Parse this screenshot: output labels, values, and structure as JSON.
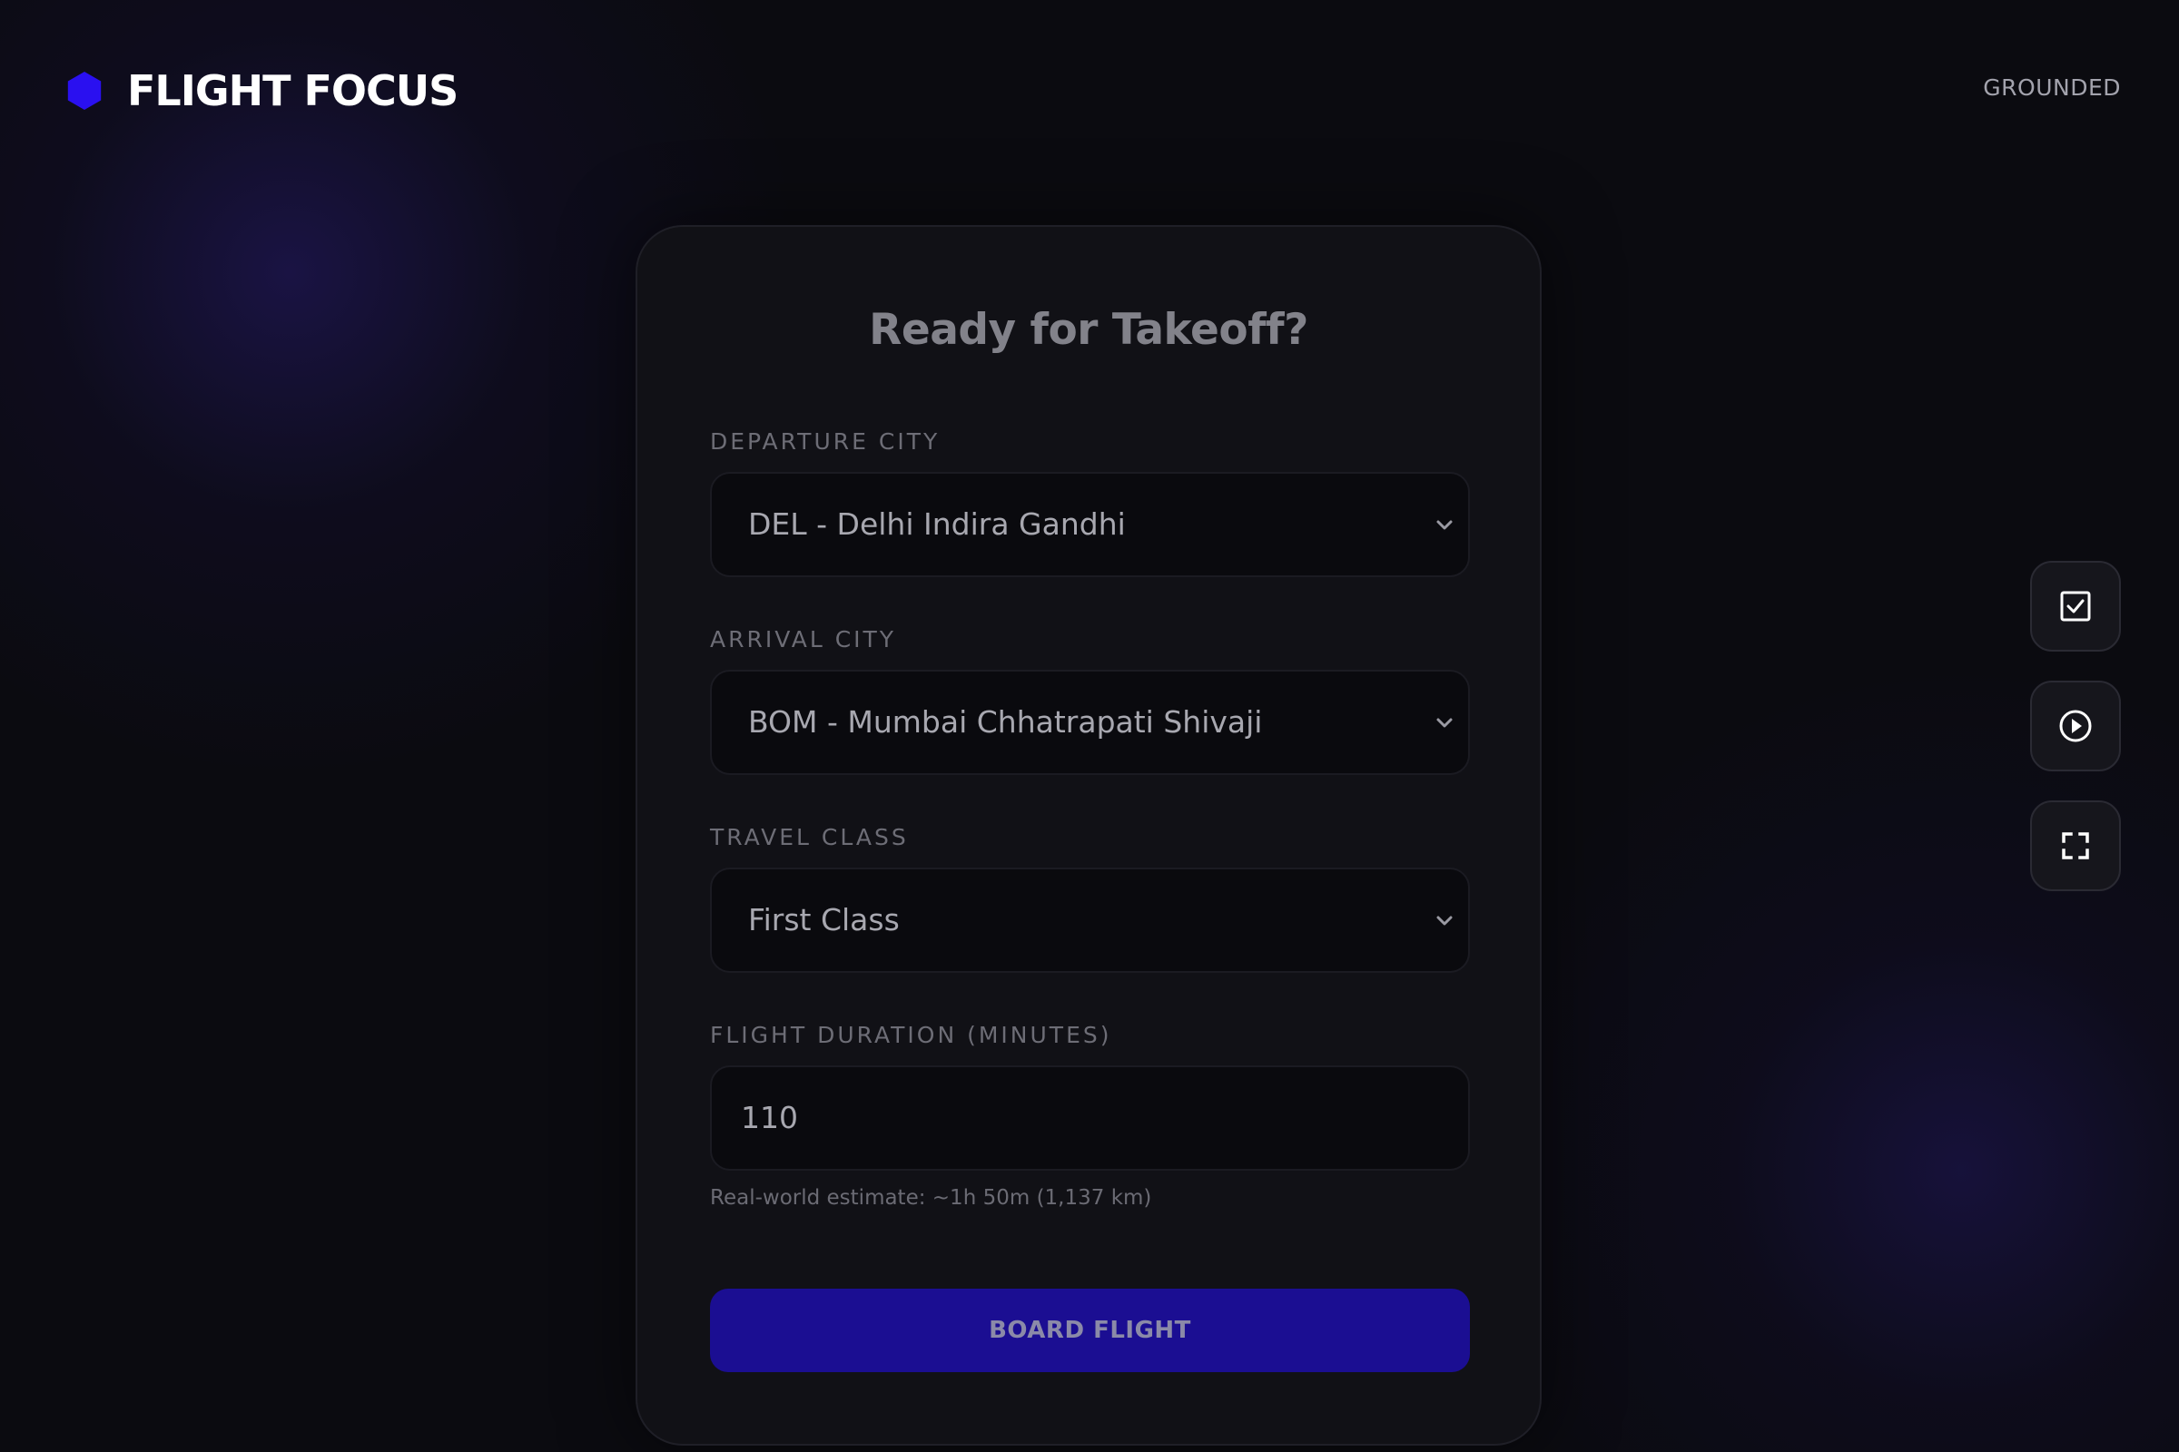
{
  "header": {
    "brand_title": "FLIGHT FOCUS",
    "brand_logo_icon": "hexagon-icon",
    "status": "GROUNDED"
  },
  "card": {
    "title": "Ready for Takeoff?",
    "departure": {
      "label": "DEPARTURE CITY",
      "value": "DEL - Delhi Indira Gandhi"
    },
    "arrival": {
      "label": "ARRIVAL CITY",
      "value": "BOM - Mumbai Chhatrapati Shivaji"
    },
    "travel_class": {
      "label": "TRAVEL CLASS",
      "value": "First Class"
    },
    "duration": {
      "label": "FLIGHT DURATION (MINUTES)",
      "value": "110",
      "hint": "Real-world estimate: ~1h 50m (1,137 km)"
    },
    "board_button_label": "BOARD FLIGHT"
  },
  "side_controls": [
    {
      "name": "tasks",
      "icon": "checkbox-icon"
    },
    {
      "name": "play",
      "icon": "play-circle-icon"
    },
    {
      "name": "fullscreen",
      "icon": "fullscreen-icon"
    }
  ],
  "colors": {
    "background": "#0b0b10",
    "card": "#111116",
    "brand_logo": "#2a10f0",
    "button": "#1b0e92"
  }
}
